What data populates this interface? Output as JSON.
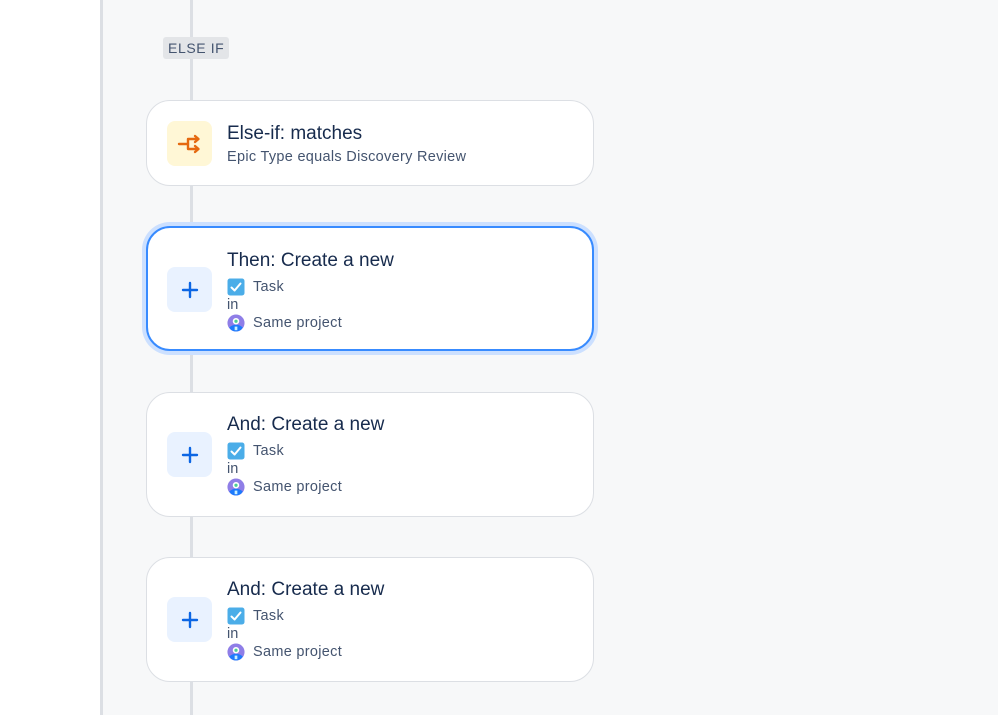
{
  "branch_label": "ELSE IF",
  "condition": {
    "title": "Else-if: matches",
    "description": "Epic Type equals Discovery Review",
    "icon": "branch-icon",
    "icon_color": "#e56910"
  },
  "actions": [
    {
      "title": "Then: Create a new",
      "issue_type": "Task",
      "connector": "in",
      "project": "Same project",
      "selected": true
    },
    {
      "title": "And: Create a new",
      "issue_type": "Task",
      "connector": "in",
      "project": "Same project",
      "selected": false
    },
    {
      "title": "And: Create a new",
      "issue_type": "Task",
      "connector": "in",
      "project": "Same project",
      "selected": false
    }
  ],
  "colors": {
    "accent": "#388bff",
    "task_icon": "#4bade8",
    "plus_icon": "#0c66e4",
    "condition_icon_bg": "#fff7d6",
    "action_icon_bg": "#e9f2ff"
  }
}
